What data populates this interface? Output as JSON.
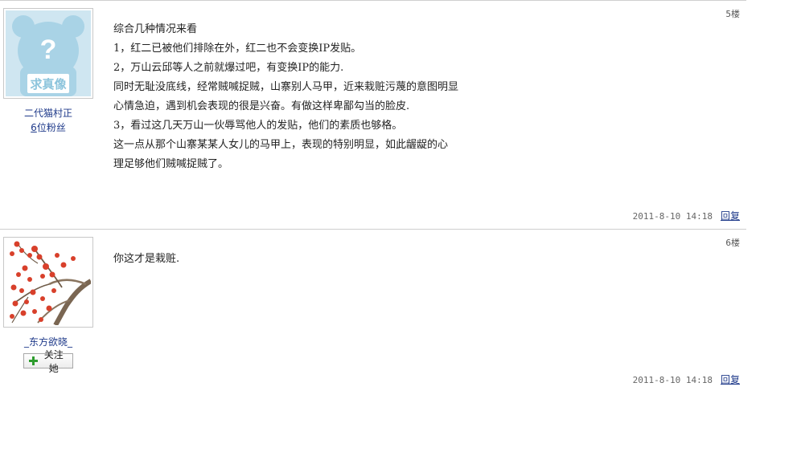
{
  "posts": [
    {
      "floor": "5楼",
      "author": "二代猫村正",
      "fans_num": "6",
      "fans_label": "位粉丝",
      "avatar_text": "求真像",
      "avatar_placeholder": "?",
      "lines": [
        "综合几种情况来看",
        "1，红二已被他们排除在外，红二也不会变换IP发贴。",
        "2，万山云邱等人之前就爆过吧，有变换IP的能力.",
        "同时无耻没底线，经常贼喊捉贼，山寨别人马甲，近来栽赃污蔑的意图明显",
        "心情急迫，遇到机会表现的很是兴奋。有做这样卑鄙勾当的脸皮.",
        "3，看过这几天万山一伙辱骂他人的发贴，他们的素质也够格。",
        "这一点从那个山寨某某人女儿的马甲上，表现的特别明显，如此龌龊的心",
        "理足够他们贼喊捉贼了。"
      ],
      "timestamp": "2011-8-10 14:18",
      "reply": "回复"
    },
    {
      "floor": "6楼",
      "author": "_东方欲晓_",
      "follow": "关注她",
      "lines": [
        "你这才是栽赃."
      ],
      "timestamp": "2011-8-10 14:18",
      "reply": "回复"
    }
  ],
  "colors": {
    "link": "#1f3a8a",
    "divider": "#cfcfcf",
    "avatar_bg": "#bfe0ef",
    "plus": "#2e9c2e"
  }
}
